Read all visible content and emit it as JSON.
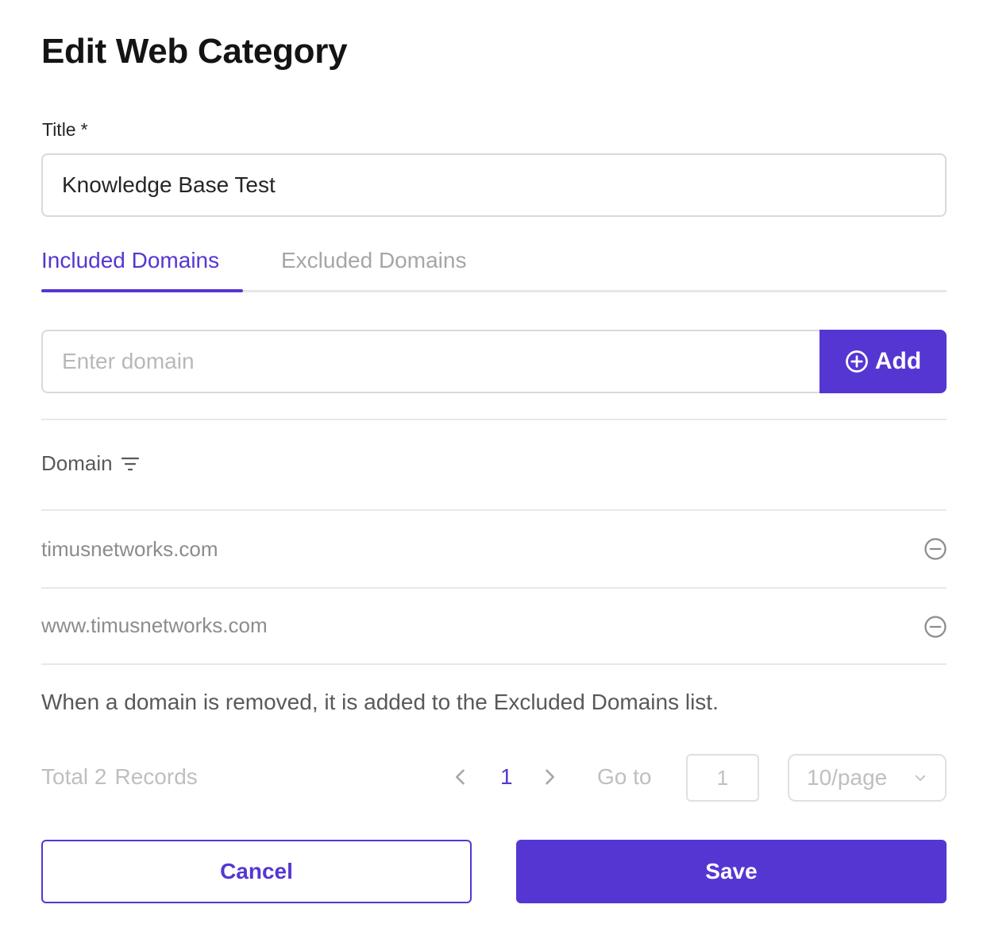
{
  "dialog": {
    "title": "Edit Web Category"
  },
  "form": {
    "title_label": "Title",
    "required_mark": "*",
    "title_value": "Knowledge Base Test"
  },
  "tabs": [
    {
      "label": "Included Domains",
      "active": true
    },
    {
      "label": "Excluded Domains",
      "active": false
    }
  ],
  "domain_entry": {
    "placeholder": "Enter domain",
    "add_label": "Add",
    "add_icon": "plus-circle-icon"
  },
  "table": {
    "column_header": "Domain",
    "header_icon": "filter-icon",
    "rows": [
      {
        "domain": "timusnetworks.com",
        "action_icon": "minus-circle-icon"
      },
      {
        "domain": "www.timusnetworks.com",
        "action_icon": "minus-circle-icon"
      }
    ]
  },
  "note": "When a domain is removed, it is added to the Excluded Domains list.",
  "pagination": {
    "total_prefix": "Total 2",
    "total_suffix": "Records",
    "current_page": "1",
    "goto_label": "Go to",
    "goto_value": "1",
    "page_size": "10/page"
  },
  "footer": {
    "cancel_label": "Cancel",
    "save_label": "Save"
  },
  "colors": {
    "accent": "#5636d3",
    "muted_text": "#8c8c8c",
    "border": "#d9d9d9"
  }
}
